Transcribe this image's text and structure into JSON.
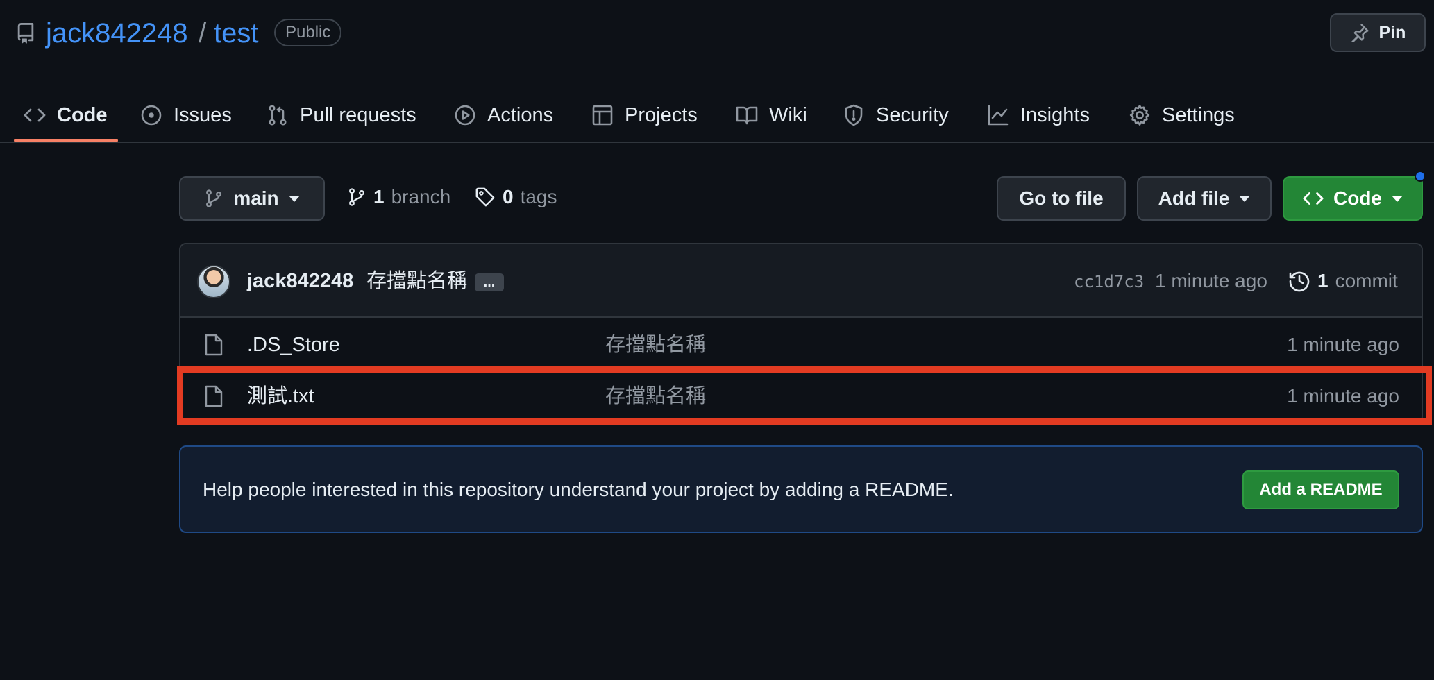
{
  "header": {
    "owner": "jack842248",
    "separator": "/",
    "repo": "test",
    "visibility": "Public",
    "pin_label": "Pin"
  },
  "tabs": [
    {
      "label": "Code",
      "icon": "code-icon",
      "active": true
    },
    {
      "label": "Issues",
      "icon": "issue-opened-icon"
    },
    {
      "label": "Pull requests",
      "icon": "git-pull-request-icon"
    },
    {
      "label": "Actions",
      "icon": "play-icon"
    },
    {
      "label": "Projects",
      "icon": "table-icon"
    },
    {
      "label": "Wiki",
      "icon": "book-icon"
    },
    {
      "label": "Security",
      "icon": "shield-icon"
    },
    {
      "label": "Insights",
      "icon": "graph-icon"
    },
    {
      "label": "Settings",
      "icon": "gear-icon"
    }
  ],
  "toolbar": {
    "branch_name": "main",
    "branch_count": "1",
    "branch_label": "branch",
    "tag_count": "0",
    "tag_label": "tags",
    "go_to_file": "Go to file",
    "add_file": "Add file",
    "code": "Code"
  },
  "latest_commit": {
    "author": "jack842248",
    "message": "存擋點名稱",
    "ellipsis": "...",
    "sha": "cc1d7c3",
    "time": "1 minute ago",
    "count": "1",
    "count_label": "commit"
  },
  "files": [
    {
      "name": ".DS_Store",
      "message": "存擋點名稱",
      "time": "1 minute ago",
      "icon": "file-icon"
    },
    {
      "name": "測試.txt",
      "message": "存擋點名稱",
      "time": "1 minute ago",
      "icon": "file-icon",
      "highlighted": true
    }
  ],
  "readme_banner": {
    "text": "Help people interested in this repository understand your project by adding a README.",
    "button": "Add a README"
  },
  "colors": {
    "background": "#0d1117",
    "link": "#4493f8",
    "primary_button": "#238636",
    "active_tab_underline": "#f78166",
    "highlight_box": "#e23b22"
  }
}
